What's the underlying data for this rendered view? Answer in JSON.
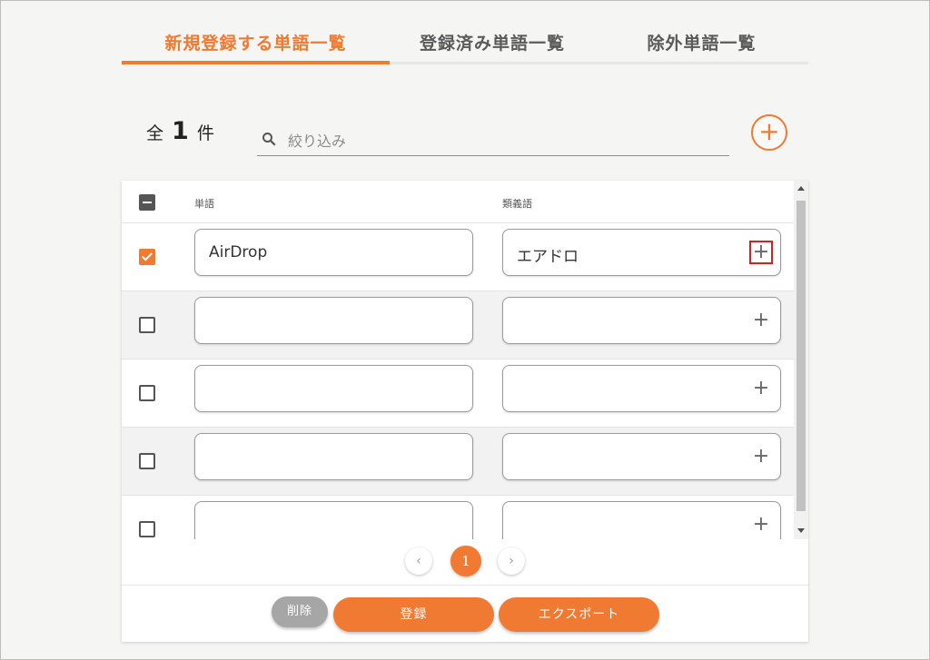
{
  "tabs": [
    {
      "label": "新規登録する単語一覧"
    },
    {
      "label": "登録済み単語一覧"
    },
    {
      "label": "除外単語一覧"
    }
  ],
  "count": {
    "prefix": "全",
    "value": "1",
    "suffix": "件"
  },
  "search": {
    "placeholder": "絞り込み"
  },
  "table": {
    "headers": {
      "word": "単語",
      "synonym": "類義語"
    },
    "rows": [
      {
        "checked": true,
        "word": "AirDrop",
        "synonym": "エアドロ"
      },
      {
        "checked": false,
        "word": "",
        "synonym": ""
      },
      {
        "checked": false,
        "word": "",
        "synonym": ""
      },
      {
        "checked": false,
        "word": "",
        "synonym": ""
      },
      {
        "checked": false,
        "word": "",
        "synonym": ""
      }
    ]
  },
  "pagination": {
    "current": "1",
    "prev": "‹",
    "next": "›"
  },
  "actions": {
    "delete": "削除",
    "register": "登録",
    "export": "エクスポート"
  },
  "colors": {
    "accent": "#f07a32",
    "highlight": "#e01b1b"
  },
  "icons": {
    "search": "search-icon",
    "add": "plus-icon"
  }
}
